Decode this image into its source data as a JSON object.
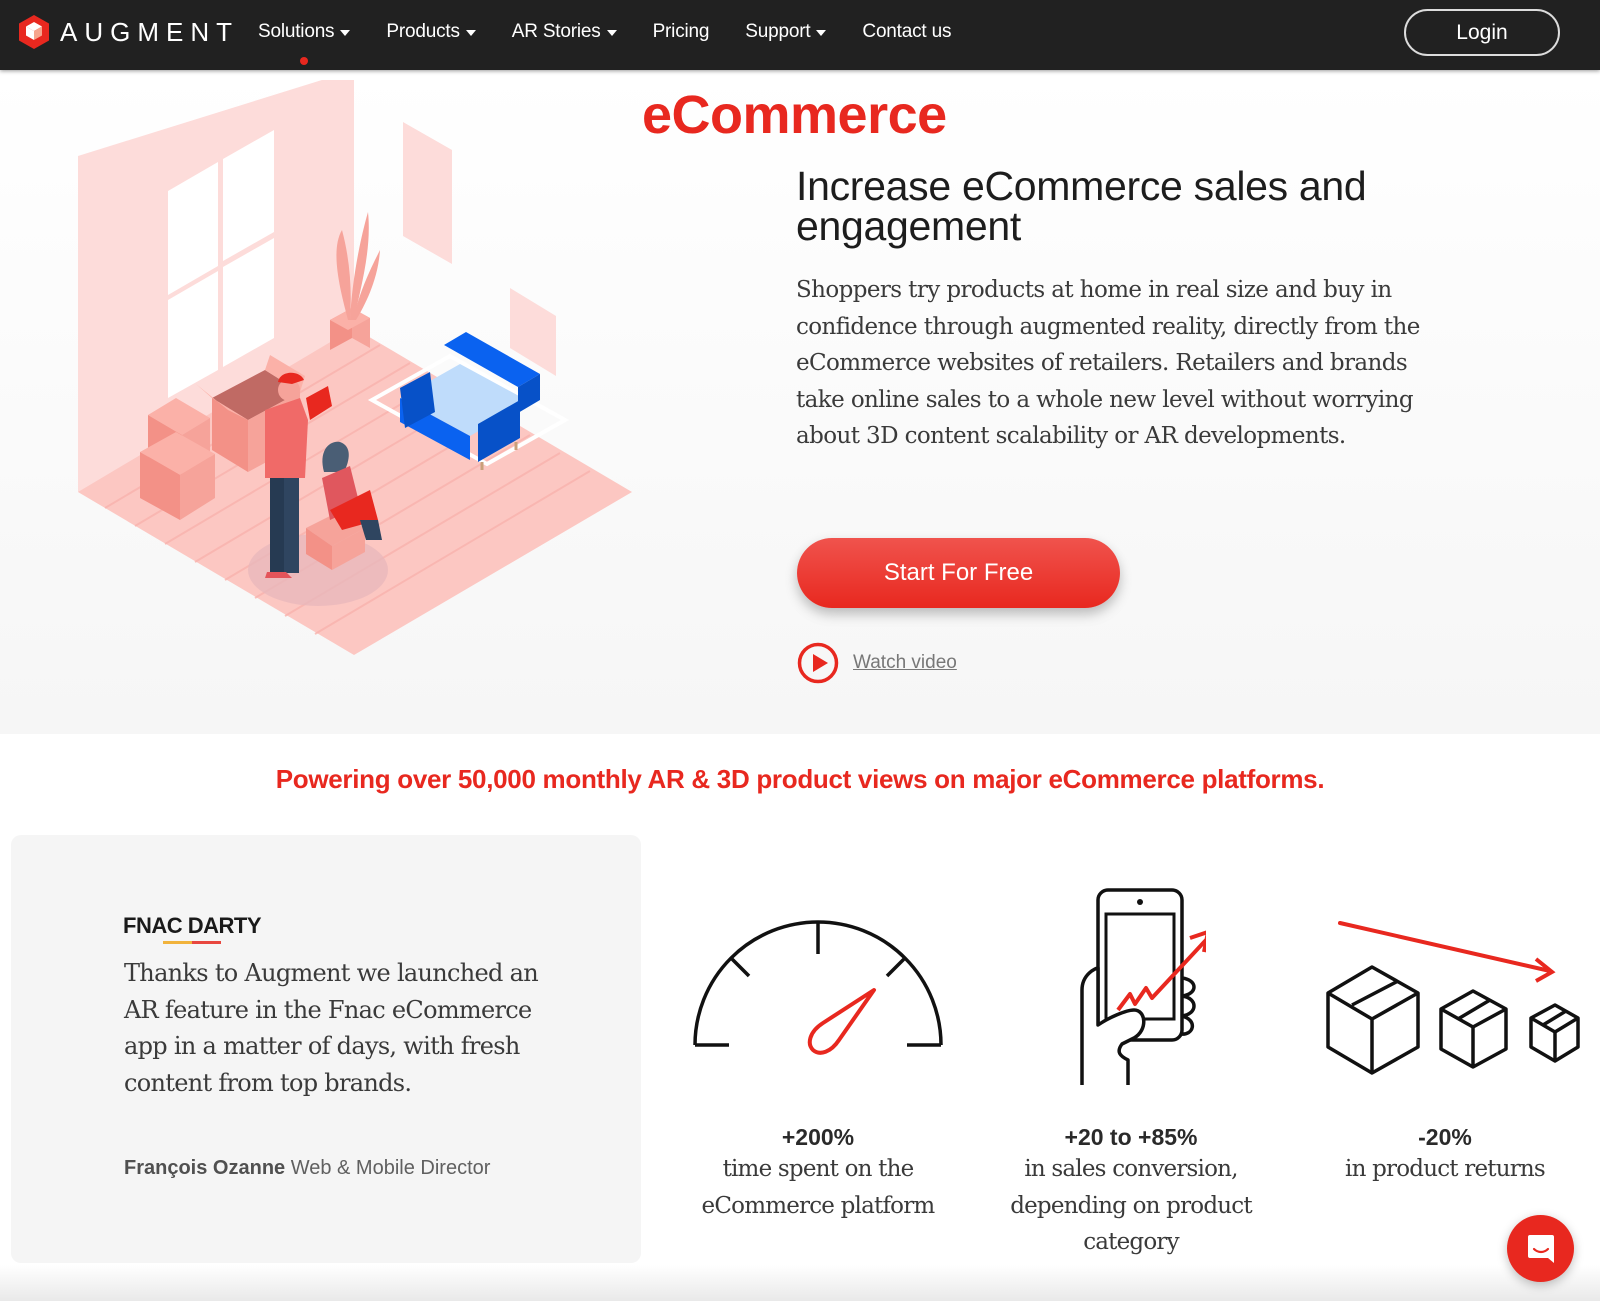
{
  "nav": {
    "brand": "AUGMENT",
    "items": [
      {
        "label": "Solutions",
        "dropdown": true,
        "active": true
      },
      {
        "label": "Products",
        "dropdown": true
      },
      {
        "label": "AR Stories",
        "dropdown": true
      },
      {
        "label": "Pricing",
        "dropdown": false
      },
      {
        "label": "Support",
        "dropdown": true
      },
      {
        "label": "Contact us",
        "dropdown": false
      }
    ],
    "login": "Login"
  },
  "hero": {
    "title": "eCommerce",
    "subtitle": "Increase eCommerce sales and engagement",
    "description": "Shoppers try products at home in real size and buy in confidence through augmented reality, directly from the eCommerce websites of retailers. Retailers and brands take online sales to a whole new level without worrying about 3D content scalability or AR developments.",
    "cta": "Start For Free",
    "watch_video": "Watch video"
  },
  "stats_section": {
    "headline": "Powering over 50,000 monthly AR & 3D product views on major eCommerce platforms.",
    "testimonial": {
      "brand": "FNAC DARTY",
      "quote": "Thanks to Augment we launched an AR feature in the Fnac eCommerce app in a matter of days, with fresh content from top brands.",
      "author_name": "François Ozanne",
      "author_role": "Web & Mobile Director"
    },
    "stats": [
      {
        "icon": "speedometer-icon",
        "value": "+200%",
        "text": "time spent on the eCommerce platform"
      },
      {
        "icon": "phone-growth-icon",
        "value": "+20 to +85%",
        "text": "in sales conversion, depending on product category"
      },
      {
        "icon": "boxes-decrease-icon",
        "value": "-20%",
        "text": "in product returns"
      }
    ]
  },
  "colors": {
    "accent": "#e8281f",
    "nav_bg": "#212121",
    "sofa": "#0a62f0"
  }
}
